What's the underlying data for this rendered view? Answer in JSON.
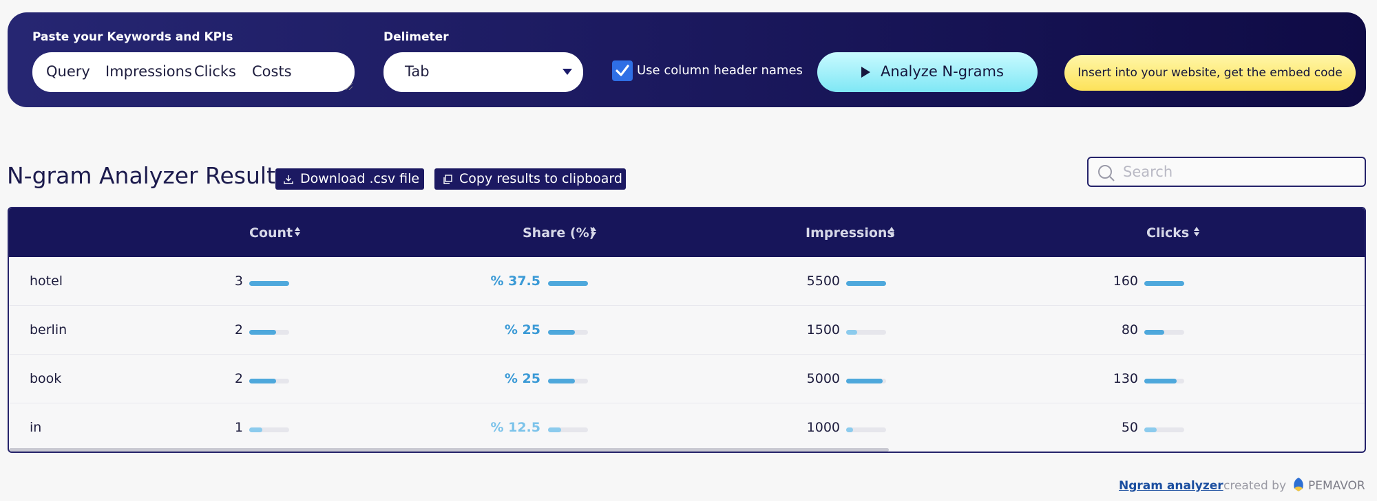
{
  "toolbar": {
    "keywords_label": "Paste your Keywords and KPIs",
    "keywords_value": [
      "Query",
      "Impressions",
      "Clicks",
      "Costs"
    ],
    "delimiter_label": "Delimeter",
    "delimiter_value": "Tab",
    "header_checkbox_label": "Use column header names",
    "header_checkbox_checked": true,
    "analyze_label": "Analyze N-grams",
    "embed_label": "Insert into your website, get the embed code"
  },
  "results": {
    "title": "N-gram Analyzer Results",
    "download_label": "Download .csv file",
    "copy_label": "Copy results to clipboard",
    "search_placeholder": "Search"
  },
  "table": {
    "columns": [
      "Count",
      "Share (%)",
      "Impressions",
      "Clicks"
    ],
    "rows": [
      {
        "word": "hotel",
        "count": "3",
        "share": "% 37.5",
        "impressions": "5500",
        "clicks": "160",
        "count_level": 1.0,
        "share_level": 1.0,
        "impressions_level": 1.0,
        "clicks_level": 1.0
      },
      {
        "word": "berlin",
        "count": "2",
        "share": "% 25",
        "impressions": "1500",
        "clicks": "80",
        "count_level": 0.67,
        "share_level": 0.67,
        "impressions_level": 0.27,
        "clicks_level": 0.5
      },
      {
        "word": "book",
        "count": "2",
        "share": "% 25",
        "impressions": "5000",
        "clicks": "130",
        "count_level": 0.67,
        "share_level": 0.67,
        "impressions_level": 0.91,
        "clicks_level": 0.81
      },
      {
        "word": "in",
        "count": "1",
        "share": "% 12.5",
        "impressions": "1000",
        "clicks": "50",
        "count_level": 0.33,
        "share_level": 0.33,
        "impressions_level": 0.18,
        "clicks_level": 0.31
      }
    ]
  },
  "footer": {
    "link": "Ngram analyzer",
    "created_by": "created by",
    "brand": "PEMAVOR"
  },
  "colors": {
    "bar_strong": "#4ea8dc",
    "bar_light": "#8ccbed",
    "share_text_strong": "#3b9ad6",
    "share_text_light": "#7cc3ea"
  }
}
